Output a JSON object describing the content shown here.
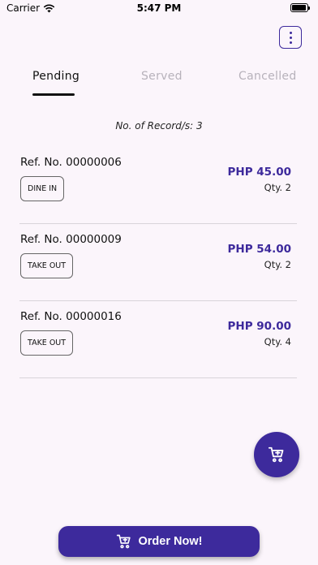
{
  "status_bar": {
    "carrier": "Carrier",
    "time": "5:47 PM"
  },
  "header": {
    "menu_icon": "more-vertical-icon"
  },
  "tabs": [
    {
      "label": "Pending",
      "active": true
    },
    {
      "label": "Served",
      "active": false
    },
    {
      "label": "Cancelled",
      "active": false
    }
  ],
  "records": {
    "count_text": "No. of Record/s: 3"
  },
  "orders": [
    {
      "ref": "Ref. No. 00000006",
      "type": "DINE IN",
      "price": "PHP 45.00",
      "qty": "Qty. 2"
    },
    {
      "ref": "Ref. No. 00000009",
      "type": "TAKE OUT",
      "price": "PHP 54.00",
      "qty": "Qty. 2"
    },
    {
      "ref": "Ref. No. 00000016",
      "type": "TAKE OUT",
      "price": "PHP 90.00",
      "qty": "Qty. 4"
    }
  ],
  "fab": {
    "icon": "cart-icon"
  },
  "footer": {
    "order_now_label": "Order Now!",
    "order_now_icon": "cart-icon"
  },
  "colors": {
    "accent": "#3d2a9c",
    "background": "#fbf5fb",
    "inactive_tab": "#b7b2bb"
  }
}
